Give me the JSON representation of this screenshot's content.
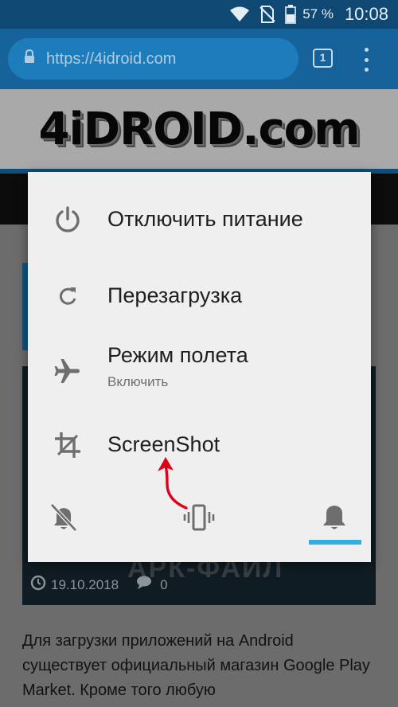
{
  "status_bar": {
    "battery_percent": "57 %",
    "time": "10:08",
    "icons": [
      "wifi-icon",
      "no-sim-icon",
      "battery-icon"
    ]
  },
  "browser": {
    "url": "https://4idroid.com",
    "tab_count": "1"
  },
  "site": {
    "logo": "4iDROID.com",
    "watermark": "АРК-ФАЙЛ",
    "date": "19.10.2018",
    "comments": "0",
    "article_text": "Для загрузки приложений на Android существует официальный магазин Google Play Market. Кроме того любую"
  },
  "dialog": {
    "options": [
      {
        "label": "Отключить питание",
        "icon": "power-icon"
      },
      {
        "label": "Перезагрузка",
        "icon": "restart-icon"
      },
      {
        "label": "Режим полета",
        "sublabel": "Включить",
        "icon": "airplane-icon"
      },
      {
        "label": "ScreenShot",
        "icon": "crop-icon"
      }
    ],
    "sound_modes": [
      "mute-icon",
      "vibrate-icon",
      "sound-on-icon"
    ],
    "active_mode": "sound-on",
    "accent_color": "#2fb0e0"
  },
  "colors": {
    "status_bar": "#0f4872",
    "toolbar": "#16629a",
    "annotation_arrow": "#e0001a"
  }
}
